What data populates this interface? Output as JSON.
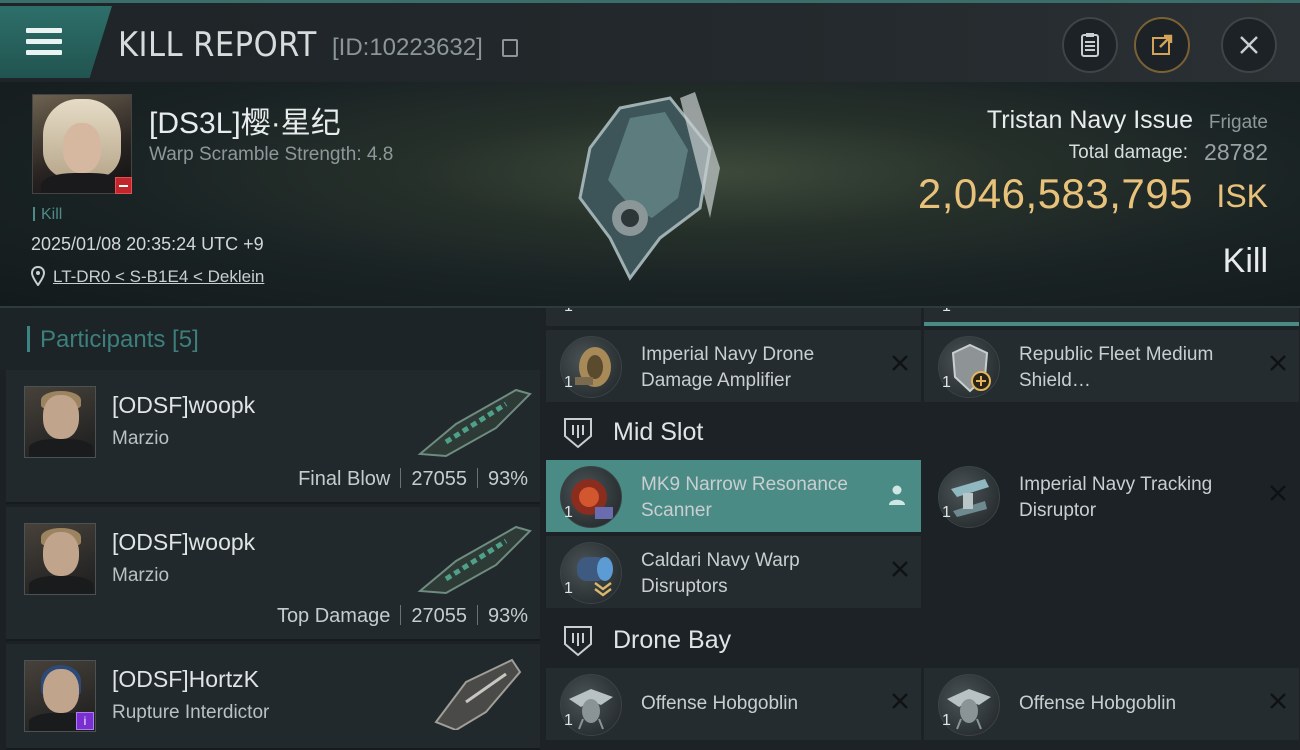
{
  "header": {
    "title": "KILL REPORT",
    "report_id": "[ID:10223632]"
  },
  "victim": {
    "name": "[DS3L]樱·星纪",
    "warp_strength": "Warp Scramble Strength: 4.8",
    "kill_tag": "Kill",
    "datetime": "2025/01/08 20:35:24 UTC +9",
    "location": "LT-DR0 < S-B1E4 < Deklein",
    "ship_name": "Tristan Navy Issue",
    "ship_class": "Frigate",
    "total_damage_label": "Total damage:",
    "total_damage": "28782",
    "isk_value": "2,046,583,795",
    "isk_unit": "ISK",
    "result": "Kill"
  },
  "participants": {
    "header": "Participants [5]",
    "rows": [
      {
        "name": "[ODSF]woopk",
        "ship": "Marzio",
        "tag": "Final Blow",
        "damage": "27055",
        "percent": "93%"
      },
      {
        "name": "[ODSF]woopk",
        "ship": "Marzio",
        "tag": "Top Damage",
        "damage": "27055",
        "percent": "93%"
      },
      {
        "name": "[ODSF]HortzK",
        "ship": "Rupture Interdictor",
        "tag": "",
        "damage": "",
        "percent": ""
      }
    ]
  },
  "fitting": {
    "top_partial": {
      "left_qty": "1",
      "right_qty": "1"
    },
    "low_slots": [
      {
        "qty": "1",
        "name": "Imperial Navy Drone Damage Amplifier",
        "icon": "drone-amplifier-icon"
      },
      {
        "qty": "1",
        "name": "Republic Fleet Medium Shield…",
        "icon": "shield-extender-icon"
      }
    ],
    "mid_slot_label": "Mid Slot",
    "mid_slots": [
      {
        "qty": "1",
        "name": "MK9 Narrow Resonance Scanner",
        "icon": "scanner-icon"
      },
      {
        "qty": "1",
        "name": "Imperial Navy Tracking Disruptor",
        "icon": "tracking-disruptor-icon"
      },
      {
        "qty": "1",
        "name": "Caldari Navy Warp Disruptors",
        "icon": "warp-disruptor-icon"
      }
    ],
    "drone_bay_label": "Drone Bay",
    "drones": [
      {
        "qty": "1",
        "name": "Offense  Hobgoblin",
        "icon": "hobgoblin-drone-icon"
      },
      {
        "qty": "1",
        "name": "Offense  Hobgoblin",
        "icon": "hobgoblin-drone-icon"
      }
    ]
  },
  "colors": {
    "accent_teal": "#3d8583",
    "isk_gold": "#e8c27a",
    "highlight_slot": "#4b8b86"
  }
}
